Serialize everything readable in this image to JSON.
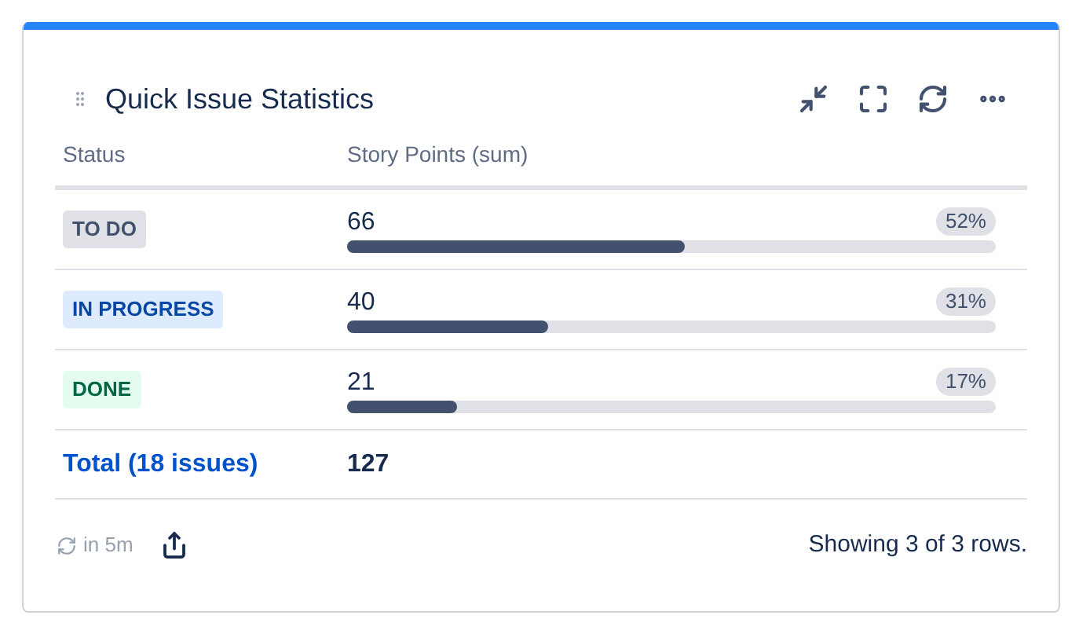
{
  "title": "Quick Issue Statistics",
  "columns": [
    "Status",
    "Story Points (sum)"
  ],
  "rows": [
    {
      "status": "TO DO",
      "kind": "todo",
      "value": "66",
      "level": 0.52,
      "percent": "52%"
    },
    {
      "status": "IN PROGRESS",
      "kind": "inprogress",
      "value": "40",
      "level": 0.31,
      "percent": "31%"
    },
    {
      "status": "DONE",
      "kind": "done",
      "value": "21",
      "level": 0.17,
      "percent": "17%"
    }
  ],
  "total": {
    "label": "Total (18 issues)",
    "value": "127"
  },
  "footer": {
    "refresh": "in 5m",
    "summary": "Showing 3 of 3 rows."
  }
}
